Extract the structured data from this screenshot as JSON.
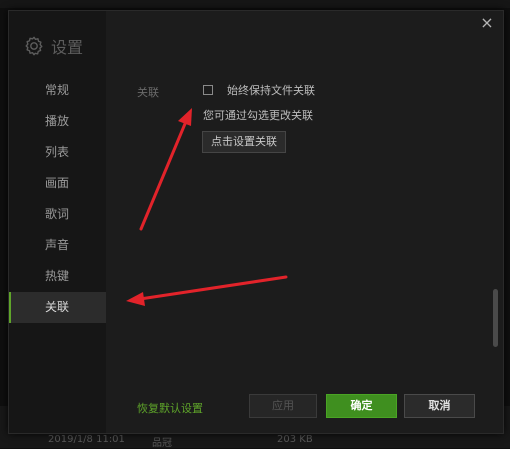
{
  "background": {
    "date": "2019/1/8 11:01",
    "artist": "品冠",
    "size": "203 KB"
  },
  "dialog": {
    "title": "设置",
    "close_icon": "×"
  },
  "sidebar": {
    "items": [
      {
        "label": "常规"
      },
      {
        "label": "播放"
      },
      {
        "label": "列表"
      },
      {
        "label": "画面"
      },
      {
        "label": "歌词"
      },
      {
        "label": "声音"
      },
      {
        "label": "热键"
      },
      {
        "label": "关联",
        "active": true
      }
    ]
  },
  "association": {
    "section_label": "关联",
    "checkbox_label": "始终保持文件关联",
    "checkbox_checked": false,
    "hint": "您可通过勾选更改关联",
    "set_button": "点击设置关联"
  },
  "footer": {
    "restore": "恢复默认设置",
    "apply": "应用",
    "ok": "确定",
    "cancel": "取消"
  },
  "colors": {
    "accent": "#5fa52a",
    "ok_button": "#3f8f1f",
    "annotation_arrow": "#e2232a"
  }
}
